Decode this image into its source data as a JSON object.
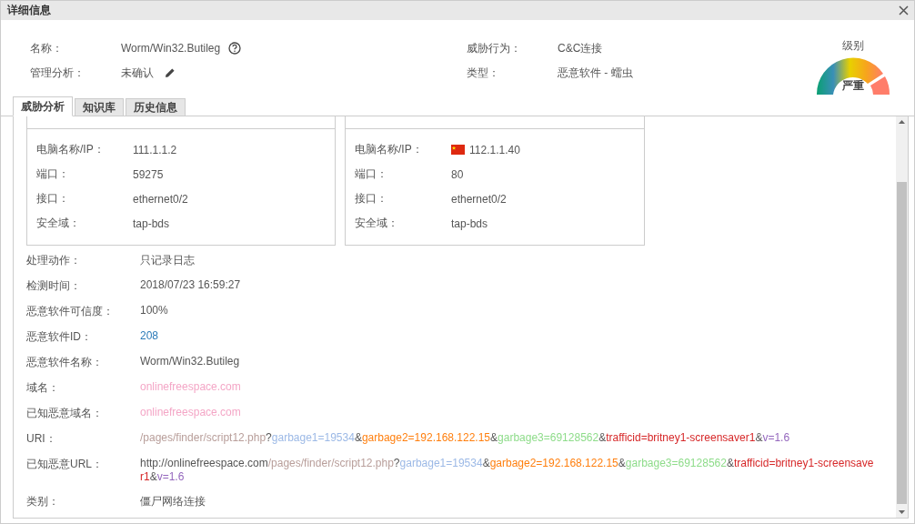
{
  "window": {
    "title": "详细信息"
  },
  "header": {
    "left": [
      {
        "label": "名称：",
        "value": "Worm/Win32.Butileg",
        "kind": "help"
      },
      {
        "label": "管理分析：",
        "value": "未确认",
        "kind": "edit"
      }
    ],
    "right": [
      {
        "label": "威胁行为：",
        "value": "C&C连接"
      },
      {
        "label": "类型：",
        "value": "恶意软件 - 蠕虫"
      }
    ],
    "severity": {
      "title": "级别",
      "label": "严重"
    }
  },
  "tabs": [
    {
      "label": "威胁分析",
      "selected": true
    },
    {
      "label": "知识库",
      "selected": false
    },
    {
      "label": "历史信息",
      "selected": false
    }
  ],
  "endpoints": [
    {
      "fields": [
        {
          "label": "电脑名称/IP：",
          "value": "111.1.1.2",
          "kind": "text"
        },
        {
          "label": "端口：",
          "value": "59275",
          "kind": "text"
        },
        {
          "label": "接口：",
          "value": "ethernet0/2",
          "kind": "text"
        },
        {
          "label": "安全域：",
          "value": "tap-bds",
          "kind": "text"
        }
      ]
    },
    {
      "fields": [
        {
          "label": "电脑名称/IP：",
          "value": "112.1.1.40",
          "kind": "flag"
        },
        {
          "label": "端口：",
          "value": "80",
          "kind": "text"
        },
        {
          "label": "接口：",
          "value": "ethernet0/2",
          "kind": "text"
        },
        {
          "label": "安全域：",
          "value": "tap-bds",
          "kind": "text"
        }
      ]
    }
  ],
  "details": [
    {
      "label": "处理动作：",
      "value": "只记录日志",
      "kind": "text"
    },
    {
      "label": "检测时间：",
      "value": "2018/07/23 16:59:27",
      "kind": "text"
    },
    {
      "label": "恶意软件可信度：",
      "value": "100%",
      "kind": "text"
    },
    {
      "label": "恶意软件ID：",
      "value": "208",
      "kind": "link"
    },
    {
      "label": "恶意软件名称：",
      "value": "Worm/Win32.Butileg",
      "kind": "text"
    },
    {
      "label": "域名：",
      "value": "onlinefreespace.com",
      "kind": "domain"
    },
    {
      "label": "已知恶意域名：",
      "value": "onlinefreespace.com",
      "kind": "domain"
    },
    {
      "label": "URI：",
      "kind": "segments",
      "segments": [
        {
          "text": "/pages/finder/script12.php",
          "color": "#b89e9a"
        },
        {
          "text": "?"
        },
        {
          "text": "garbage1=19534",
          "color": "#9cb9e6"
        },
        {
          "text": "&"
        },
        {
          "text": "garbage2=192.168.122.15",
          "color": "#ff7f0e"
        },
        {
          "text": "&"
        },
        {
          "text": "garbage3=69128562",
          "color": "#8edc8a"
        },
        {
          "text": "&"
        },
        {
          "text": "trafficid=britney1-screensaver1",
          "color": "#d62728"
        },
        {
          "text": "&"
        },
        {
          "text": "v=1.6",
          "color": "#9467bd"
        }
      ]
    },
    {
      "label": "已知恶意URL：",
      "kind": "segments",
      "segments": [
        {
          "text": "http://onlinefreespace.com"
        },
        {
          "text": "/pages/finder/script12.php",
          "color": "#b89e9a"
        },
        {
          "text": "?"
        },
        {
          "text": "garbage1=19534",
          "color": "#9cb9e6"
        },
        {
          "text": "&"
        },
        {
          "text": "garbage2=192.168.122.15",
          "color": "#ff7f0e"
        },
        {
          "text": "&"
        },
        {
          "text": "garbage3=69128562",
          "color": "#8edc8a"
        },
        {
          "text": "&"
        },
        {
          "text": "trafficid=britney1-screensaver1",
          "color": "#d62728"
        },
        {
          "text": "&"
        },
        {
          "text": "v=1.6",
          "color": "#9467bd"
        }
      ]
    },
    {
      "label": "类别：",
      "value": "僵尸网络连接",
      "kind": "text"
    }
  ]
}
